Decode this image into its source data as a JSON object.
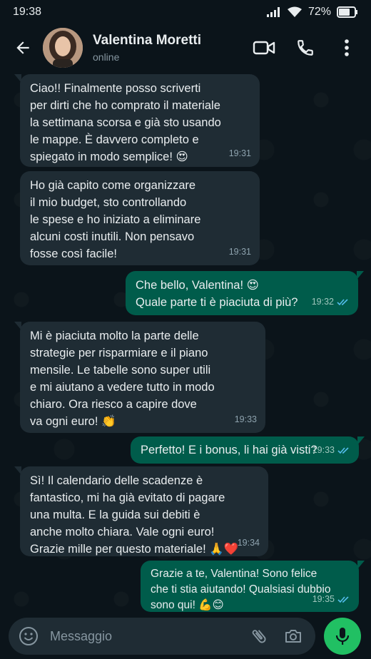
{
  "status_bar": {
    "time": "19:38",
    "battery": "72%"
  },
  "header": {
    "contact_name": "Valentina Moretti",
    "contact_status": "online",
    "icons": [
      "back-arrow-icon",
      "video-call-icon",
      "phone-icon",
      "more-vert-icon"
    ]
  },
  "messages": [
    {
      "direction": "in",
      "text": "Ciao!! Finalmente posso scriverti\nper dirti che ho comprato il materiale\nla settimana scorsa e già sto usando\nle mappe. È davvero completo e\nspiegato in modo semplice! 😍",
      "time": "19:31"
    },
    {
      "direction": "in",
      "text": "Ho già capito come organizzare\nil mio budget, sto controllando\nle spese e ho iniziato a eliminare\nalcuni costi inutili. Non pensavo\nfosse così facile!",
      "time": "19:31"
    },
    {
      "direction": "out",
      "text": "Che bello, Valentina! 😍\nQuale parte ti è piaciuta di più?",
      "time": "19:32"
    },
    {
      "direction": "in",
      "text": "Mi è piaciuta molto la parte delle\nstrategie per risparmiare e il piano\nmensile. Le tabelle sono super utili\ne mi aiutano a vedere tutto in modo\nchiaro. Ora riesco a capire dove\nva ogni euro! 👏",
      "time": "19:33"
    },
    {
      "direction": "out",
      "text": "Perfetto! E i bonus, li hai già visti?",
      "time": "19:33"
    },
    {
      "direction": "in",
      "text": "Sì! Il calendario delle scadenze è\nfantastico, mi ha già evitato di pagare\nuna multa. E la guida sui debiti è\nanche molto chiara. Vale ogni euro!\nGrazie mille per questo materiale! 🙏❤️",
      "time": "19:34"
    },
    {
      "direction": "out",
      "text": "Grazie a te, Valentina! Sono felice\nche ti stia aiutando! Qualsiasi dubbio\nsono qui! 💪😊",
      "time": "19:35"
    }
  ],
  "composer": {
    "placeholder": "Messaggio"
  },
  "colors": {
    "background": "#0b141a",
    "incoming_bubble": "#1f2c34",
    "outgoing_bubble": "#005c4b",
    "read_ticks": "#53bdeb",
    "mic_button": "#21c063"
  }
}
